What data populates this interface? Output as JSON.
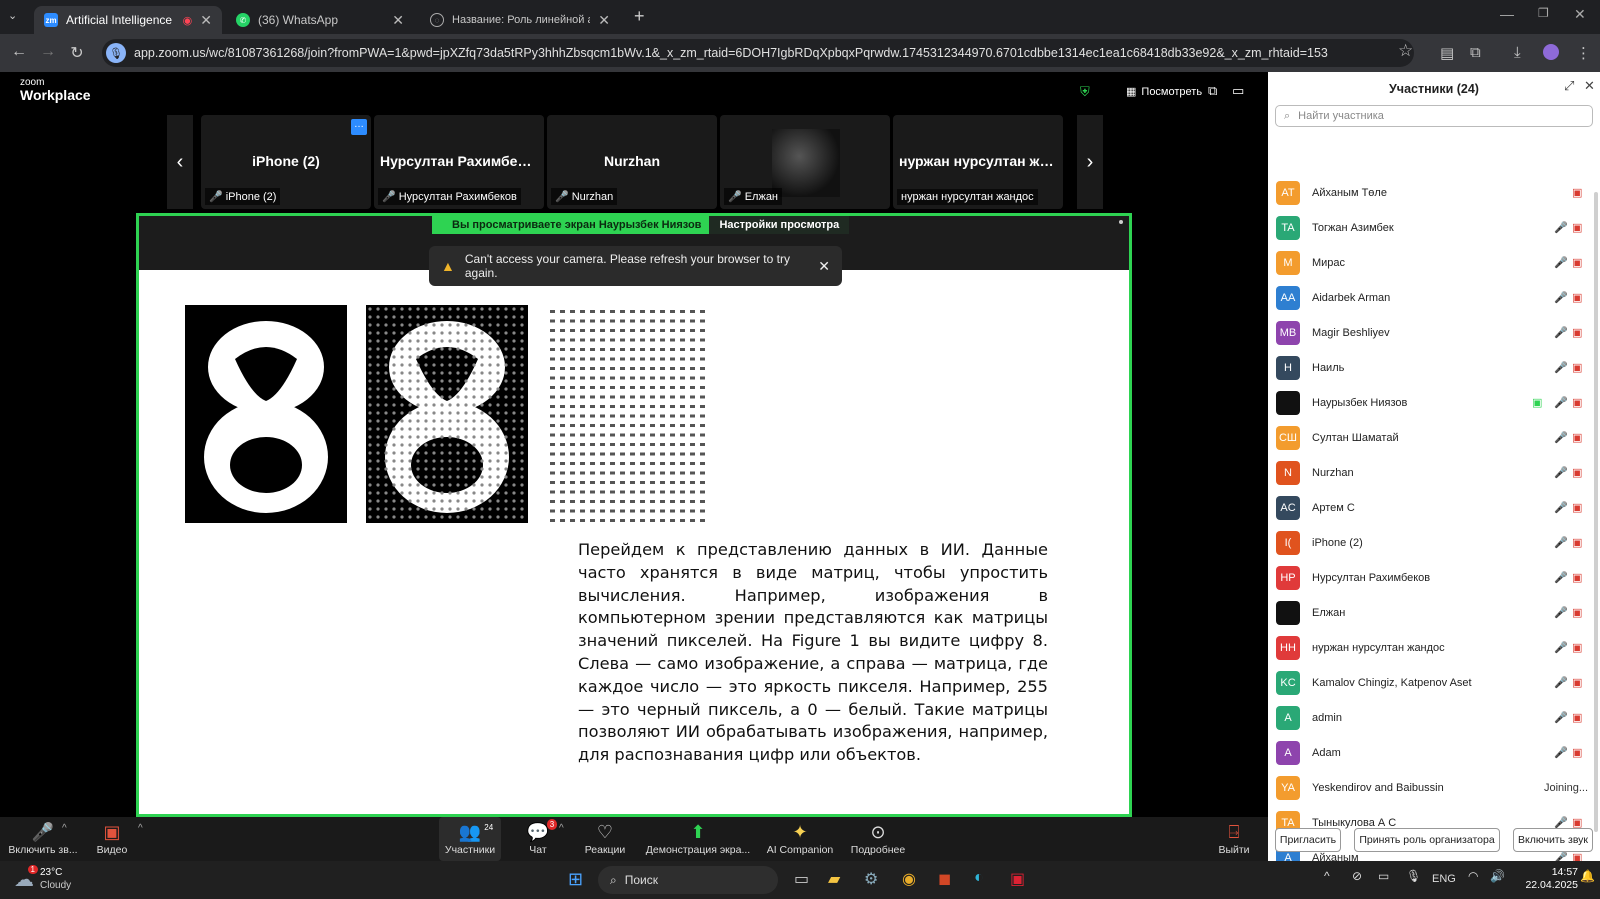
{
  "browser": {
    "tabs": [
      {
        "title": "Artificial Intelligence & App",
        "favicon": "zoom-favicon",
        "active": true
      },
      {
        "title": "(36) WhatsApp",
        "favicon": "whatsapp-favicon",
        "active": false
      },
      {
        "title": "Название: Роль линейной алг",
        "favicon": "globe-favicon",
        "active": false
      }
    ],
    "new_tab": "+",
    "url": "app.zoom.us/wc/81087361268/join?fromPWA=1&pwd=jpXZfq73da5tRPy3hhhZbsqcm1bWv.1&_x_zm_rtaid=6DOH7IgbRDqXpbqxPqrwdw.1745312344970.6701cdbbe1314ec1ea1c68418db33e92&_x_zm_rhtaid=153"
  },
  "zoom": {
    "logo_small": "zoom",
    "logo_big": "Workplace",
    "view_label": "Посмотреть"
  },
  "strip": {
    "tiles": [
      {
        "name": "iPhone (2)",
        "tag": "iPhone (2)"
      },
      {
        "name": "Нурсултан Рахимбеков",
        "tag": "Нурсултан Рахимбеков"
      },
      {
        "name": "Nurzhan",
        "tag": "Nurzhan"
      },
      {
        "name": "",
        "tag": "Елжан"
      },
      {
        "name": "нуржан нурсултан жан...",
        "tag": "нуржан нурсултан жандос"
      }
    ]
  },
  "share": {
    "banner_viewing": "Вы просматриваете экран",
    "banner_person": "Наурызбек Ниязов",
    "banner_settings": "Настройки просмотра",
    "toast": "Can't access your camera. Please refresh your browser to try again.",
    "slide_text": "Перейдем к представлению данных в ИИ. Данные часто хранятся в виде матриц, чтобы упростить вычисления. Например, изображения в компьютерном зрении представляются как матрицы значений пикселей. На Figure 1 вы видите цифру 8. Слева — само изображение, а справа — матрица, где каждое число — это яркость пикселя. Например, 255 — это черный пиксель, а 0 — белый. Такие матрицы позволяют ИИ обрабатывать изображения, например, для распознавания цифр или объектов."
  },
  "toolbar": {
    "mic": "Включить зв...",
    "video": "Видео",
    "participants": "Участники",
    "participants_count": "24",
    "chat": "Чат",
    "chat_badge": "3",
    "reactions": "Реакции",
    "share": "Демонстрация экра...",
    "ai": "AI Companion",
    "more": "Подробнее",
    "leave": "Выйти"
  },
  "panel": {
    "title": "Участники (24)",
    "search_placeholder": "Найти участника",
    "participants": [
      {
        "initials": "AT",
        "name": "Айханым Төле",
        "color": "#f39c2e"
      },
      {
        "initials": "TA",
        "name": "Тогжан Азимбек",
        "color": "#2aa876"
      },
      {
        "initials": "M",
        "name": "Мирас",
        "color": "#f39c2e"
      },
      {
        "initials": "AA",
        "name": "Aidarbek Arman",
        "color": "#2e7fd1"
      },
      {
        "initials": "MB",
        "name": "Magir Beshliyev",
        "color": "#8e44ad"
      },
      {
        "initials": "H",
        "name": "Наиль",
        "color": "#34495e"
      },
      {
        "initials": "",
        "name": "Наурызбек Ниязов",
        "color": "#111111"
      },
      {
        "initials": "СШ",
        "name": "Султан Шаматай",
        "color": "#f39c2e"
      },
      {
        "initials": "N",
        "name": "Nurzhan",
        "color": "#e0531e"
      },
      {
        "initials": "AC",
        "name": "Артем С",
        "color": "#34495e"
      },
      {
        "initials": "I(",
        "name": "iPhone (2)",
        "color": "#e0531e"
      },
      {
        "initials": "НР",
        "name": "Нурсултан Рахимбеков",
        "color": "#e03a3a"
      },
      {
        "initials": "",
        "name": "Елжан",
        "color": "#111111"
      },
      {
        "initials": "НН",
        "name": "нуржан нурсултан жандос",
        "color": "#e03a3a"
      },
      {
        "initials": "KC",
        "name": "Kamalov Chingiz, Katpenov Aset",
        "color": "#2aa876"
      },
      {
        "initials": "A",
        "name": "admin",
        "color": "#2aa876"
      },
      {
        "initials": "A",
        "name": "Adam",
        "color": "#8e44ad"
      },
      {
        "initials": "YA",
        "name": "Yeskendirov and Baibussin",
        "color": "#f39c2e"
      },
      {
        "initials": "TA",
        "name": "Тыныкулова А С",
        "color": "#f39c2e"
      },
      {
        "initials": "A",
        "name": "Айханым",
        "color": "#2e7fd1"
      }
    ],
    "joining_label": "Joining...",
    "invite": "Пригласить",
    "host_role": "Принять роль организатора",
    "audio_on": "Включить звук"
  },
  "taskbar": {
    "weather_temp": "23°C",
    "weather_desc": "Cloudy",
    "weather_badge": "1",
    "search": "Поиск",
    "lang": "ENG",
    "time": "14:57",
    "date": "22.04.2025"
  }
}
